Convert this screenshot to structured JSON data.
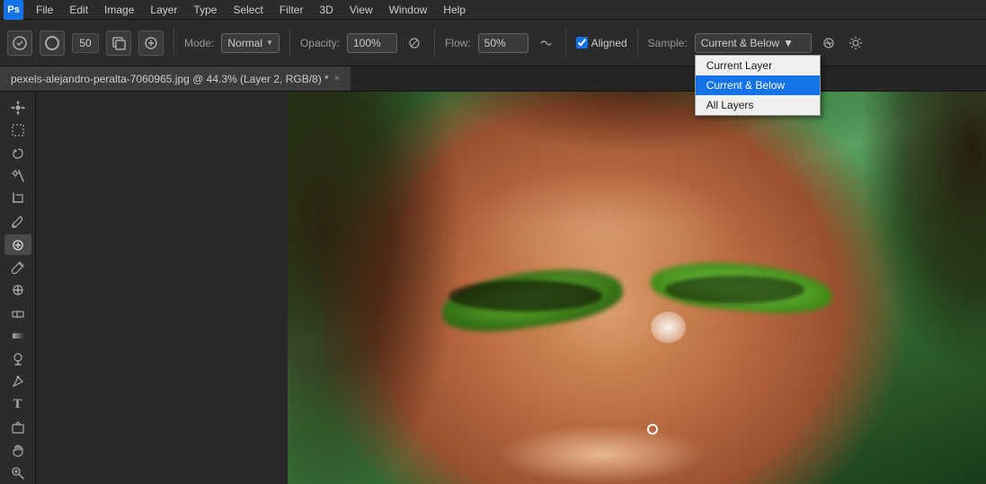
{
  "app": {
    "logo": "Ps",
    "logo_bg": "#1473e6"
  },
  "menubar": {
    "items": [
      "File",
      "Edit",
      "Image",
      "Layer",
      "Type",
      "Select",
      "Filter",
      "3D",
      "View",
      "Window",
      "Help"
    ]
  },
  "toolbar": {
    "mode_label": "Mode:",
    "mode_value": "Normal",
    "opacity_label": "Opacity:",
    "opacity_value": "100%",
    "flow_label": "Flow:",
    "flow_value": "50%",
    "aligned_label": "Aligned",
    "sample_label": "Sample:",
    "sample_value": "Current & Below",
    "brush_size": "50"
  },
  "sample_dropdown": {
    "options": [
      {
        "label": "Current Layer",
        "selected": false
      },
      {
        "label": "Current & Below",
        "selected": true
      },
      {
        "label": "All Layers",
        "selected": false
      }
    ]
  },
  "tab": {
    "filename": "pexels-alejandro-peralta-7060965.jpg @ 44.3% (Layer 2, RGB/8) *",
    "close": "×"
  },
  "left_tools": [
    {
      "name": "move",
      "icon": "✛"
    },
    {
      "name": "marquee",
      "icon": "⬚"
    },
    {
      "name": "lasso",
      "icon": "⌒"
    },
    {
      "name": "wand",
      "icon": "✦"
    },
    {
      "name": "crop",
      "icon": "⛶"
    },
    {
      "name": "eyedropper",
      "icon": "⊘"
    },
    {
      "name": "heal",
      "icon": "⊕"
    },
    {
      "name": "brush",
      "icon": "✏"
    },
    {
      "name": "clone",
      "icon": "✐"
    },
    {
      "name": "eraser",
      "icon": "◻"
    },
    {
      "name": "gradient",
      "icon": "▦"
    },
    {
      "name": "dodge",
      "icon": "◑"
    },
    {
      "name": "pen",
      "icon": "✒"
    },
    {
      "name": "text",
      "icon": "T"
    },
    {
      "name": "shape",
      "icon": "◇"
    },
    {
      "name": "hand",
      "icon": "✋"
    },
    {
      "name": "zoom",
      "icon": "⌕"
    }
  ]
}
